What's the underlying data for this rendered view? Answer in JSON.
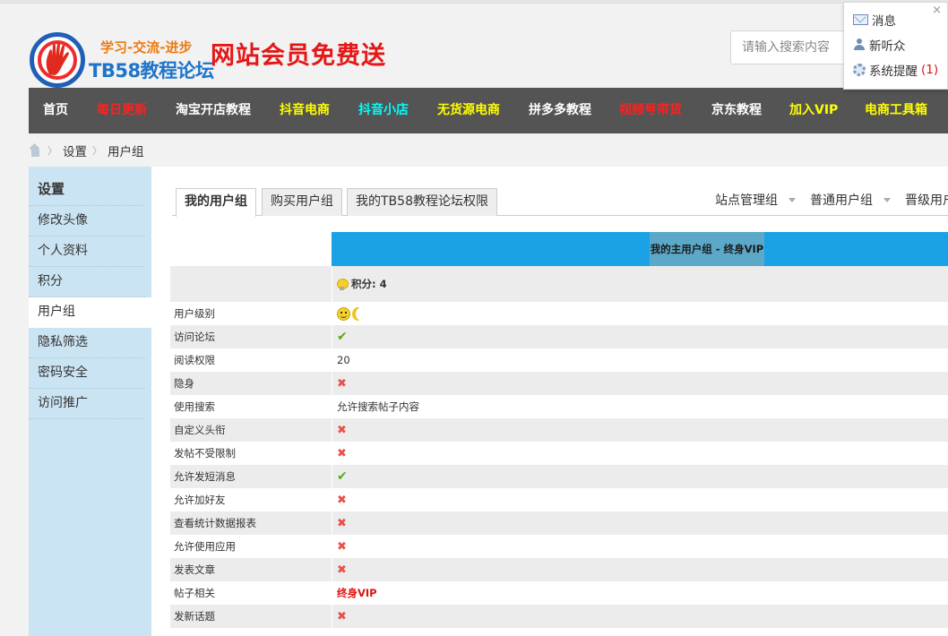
{
  "header": {
    "slogan": "学习-交流-进步",
    "site_name": "TB58教程论坛",
    "promo": "网站会员免费送",
    "search_placeholder": "请输入搜索内容"
  },
  "notifications": {
    "items": [
      {
        "label": "消息",
        "icon": "mail-icon"
      },
      {
        "label": "新听众",
        "icon": "user-icon"
      },
      {
        "label": "系统提醒",
        "count": "(1)",
        "icon": "gear-icon"
      }
    ],
    "close": "×"
  },
  "nav": [
    {
      "label": "首页",
      "color": "#ffffff"
    },
    {
      "label": "每日更新",
      "color": "#ff2020"
    },
    {
      "label": "淘宝开店教程",
      "color": "#ffffff"
    },
    {
      "label": "抖音电商",
      "color": "#ffff00"
    },
    {
      "label": "抖音小店",
      "color": "#00ffff"
    },
    {
      "label": "无货源电商",
      "color": "#ffff00"
    },
    {
      "label": "拼多多教程",
      "color": "#ffffff"
    },
    {
      "label": "视频号带货",
      "color": "#ff2020"
    },
    {
      "label": "京东教程",
      "color": "#ffffff"
    },
    {
      "label": "加入VIP",
      "color": "#ffff00"
    },
    {
      "label": "电商工具箱",
      "color": "#ffff00"
    }
  ],
  "breadcrumb": [
    "设置",
    "用户组"
  ],
  "sidebar": {
    "title": "设置",
    "items": [
      "修改头像",
      "个人资料",
      "积分",
      "用户组",
      "隐私筛选",
      "密码安全",
      "访问推广"
    ],
    "active": "用户组"
  },
  "tabs": [
    "我的用户组",
    "购买用户组",
    "我的TB58教程论坛权限"
  ],
  "right_tabs": [
    "站点管理组",
    "普通用户组",
    "晋级用户组"
  ],
  "table": {
    "header": "我的主用户组 - 终身VIP",
    "points": "积分: 4",
    "rows": [
      {
        "key": "用户级别",
        "type": "icons"
      },
      {
        "key": "访问论坛",
        "type": "yes",
        "value": "✔"
      },
      {
        "key": "阅读权限",
        "type": "text",
        "value": "20"
      },
      {
        "key": "隐身",
        "type": "no",
        "value": "✖"
      },
      {
        "key": "使用搜索",
        "type": "text",
        "value": "允许搜索帖子内容"
      },
      {
        "key": "自定义头衔",
        "type": "no",
        "value": "✖"
      },
      {
        "key": "发帖不受限制",
        "type": "no",
        "value": "✖"
      },
      {
        "key": "允许发短消息",
        "type": "yes",
        "value": "✔"
      },
      {
        "key": "允许加好友",
        "type": "no",
        "value": "✖"
      },
      {
        "key": "查看统计数据报表",
        "type": "no",
        "value": "✖"
      },
      {
        "key": "允许使用应用",
        "type": "no",
        "value": "✖"
      },
      {
        "key": "发表文章",
        "type": "no",
        "value": "✖"
      },
      {
        "key": "帖子相关",
        "type": "vip",
        "value": "终身VIP"
      },
      {
        "key": "发新话题",
        "type": "no",
        "value": "✖"
      }
    ]
  }
}
